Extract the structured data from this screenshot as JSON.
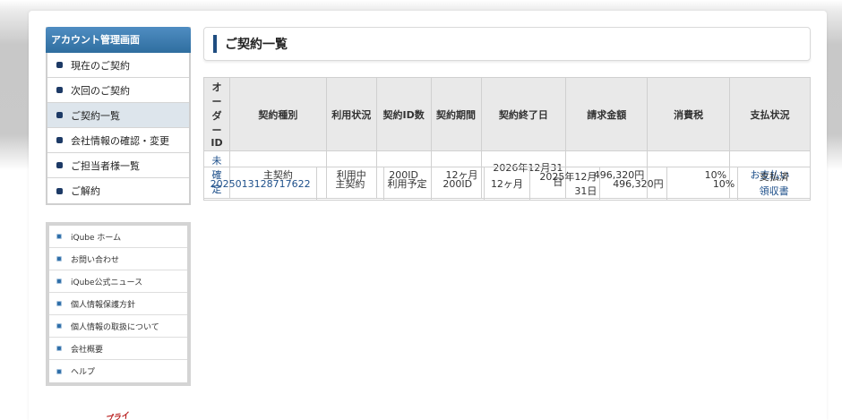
{
  "sidebar": {
    "title": "アカウント管理画面",
    "items": [
      {
        "label": "現在のご契約"
      },
      {
        "label": "次回のご契約"
      },
      {
        "label": "ご契約一覧"
      },
      {
        "label": "会社情報の確認・変更"
      },
      {
        "label": "ご担当者様一覧"
      },
      {
        "label": "ご解約"
      }
    ],
    "active_index": 2
  },
  "links": [
    {
      "label": "iQube ホーム"
    },
    {
      "label": "お問い合わせ"
    },
    {
      "label": "iQube公式ニュース"
    },
    {
      "label": "個人情報保護方針"
    },
    {
      "label": "個人情報の取扱について"
    },
    {
      "label": "会社概要"
    },
    {
      "label": "ヘルプ"
    }
  ],
  "badge_text": "プライ",
  "page": {
    "title": "ご契約一覧"
  },
  "table": {
    "headers": [
      "オーダーID",
      "契約種別",
      "利用状況",
      "契約ID数",
      "契約期間",
      "契約終了日",
      "請求金額",
      "消費税",
      "支払状況"
    ],
    "row1": {
      "order_id": "未確定",
      "type": "主契約",
      "status": "利用中",
      "id_count": "200ID",
      "period": "12ヶ月",
      "end_date": "2026年12月31日",
      "amount": "496,320円",
      "tax": "10%",
      "payment": "お支払い"
    },
    "row2": {
      "order_id": "2025013128717622",
      "type": "主契約",
      "status": "利用予定",
      "id_count": "200ID",
      "period": "12ヶ月",
      "end_date": "2025年12月31日",
      "amount": "496,320円",
      "tax": "10%",
      "payment_status": "支払済",
      "receipt": "領収書"
    }
  },
  "colors": {
    "accent": "#2f6e9f",
    "link": "#1d4f8a",
    "active_item": "#dde5ec"
  }
}
